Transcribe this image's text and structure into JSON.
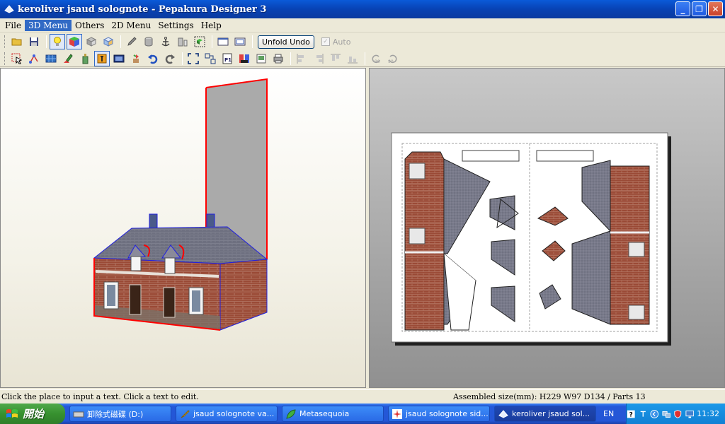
{
  "window": {
    "title": "keroliver jsaud solognote - Pepakura Designer 3"
  },
  "menu": [
    {
      "label": "File"
    },
    {
      "label": "3D Menu",
      "active": true
    },
    {
      "label": "Others"
    },
    {
      "label": "2D Menu"
    },
    {
      "label": "Settings"
    },
    {
      "label": "Help"
    }
  ],
  "toolbar1": {
    "unfold_undo_label": "Unfold Undo",
    "auto_label": "Auto",
    "auto_checked": true
  },
  "toolbar2": {
    "p1_label": "P1",
    "rotate_left_label": "90",
    "rotate_right_label": "90"
  },
  "status": {
    "left": "Click the place to input a text. Click a text to edit.",
    "right": "Assembled size(mm): H229  W97  D134  / Parts 13"
  },
  "taskbar": {
    "start_label": "開始",
    "tasks": [
      {
        "label": "卸除式磁碟 (D:)"
      },
      {
        "label": "jsaud solognote va..."
      },
      {
        "label": "Metasequoia"
      },
      {
        "label": "jsaud solognote sid..."
      },
      {
        "label": "keroliver jsaud sol...",
        "active": true
      }
    ],
    "lang": "EN",
    "clock": "11:32"
  },
  "colors": {
    "edge_red": "#ff0000",
    "edge_blue": "#2020e0",
    "brick": "#9a4a36",
    "roof": "#6e7080"
  }
}
